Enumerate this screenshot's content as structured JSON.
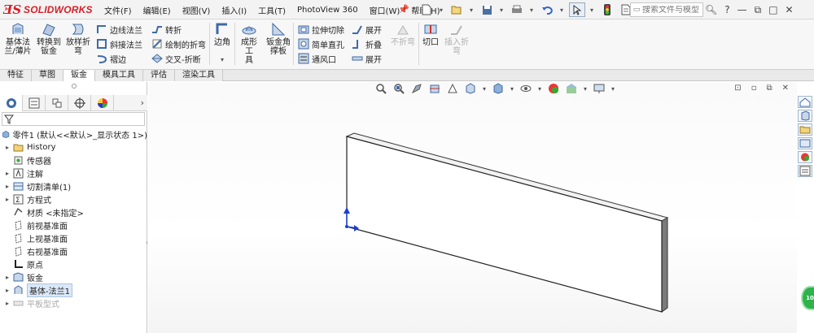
{
  "app": {
    "logo_text": "SOLIDWORKS"
  },
  "menu": [
    "文件(F)",
    "编辑(E)",
    "视图(V)",
    "插入(I)",
    "工具(T)",
    "PhotoView 360",
    "窗口(W)",
    "帮助(H)"
  ],
  "search": {
    "placeholder": "搜索文件与模型"
  },
  "title_right": {
    "help": "?"
  },
  "ribbon": {
    "base_flange": "基体法\n兰/薄片",
    "convert_to_sheet": "转换到\n钣金",
    "lofted_bend": "放样折\n弯",
    "edge_flange": "边线法兰",
    "miter_flange": "斜接法兰",
    "hem": "褶边",
    "jog": "转折",
    "sketched_bend": "绘制的折弯",
    "cross_break": "交叉-折断",
    "corners": "边角",
    "forming_tool": "成形工\n具",
    "sheet_gusset": "钣金角\n撑板",
    "extruded_cut": "拉伸切除",
    "simple_hole": "简单直孔",
    "vent": "通风口",
    "unfold": "展开",
    "fold": "折叠",
    "flatten": "展开",
    "no_bends": "不折弯",
    "rip": "切口",
    "insert_bends": "插入折\n弯"
  },
  "tabs": [
    {
      "label": "特征",
      "active": false
    },
    {
      "label": "草图",
      "active": false
    },
    {
      "label": "钣金",
      "active": true
    },
    {
      "label": "模具工具",
      "active": false
    },
    {
      "label": "评估",
      "active": false
    },
    {
      "label": "渲染工具",
      "active": false
    }
  ],
  "tree": {
    "root": "零件1 (默认<<默认>_显示状态 1>)",
    "items": [
      {
        "label": "History",
        "expand": true
      },
      {
        "label": "传感器",
        "expand": false
      },
      {
        "label": "注解",
        "expand": true
      },
      {
        "label": "切割清单(1)",
        "expand": true
      },
      {
        "label": "方程式",
        "expand": true
      },
      {
        "label": "材质 <未指定>",
        "expand": false
      },
      {
        "label": "前视基准面",
        "expand": false
      },
      {
        "label": "上视基准面",
        "expand": false
      },
      {
        "label": "右视基准面",
        "expand": false
      },
      {
        "label": "原点",
        "expand": false
      },
      {
        "label": "钣金",
        "expand": true
      },
      {
        "label": "基体-法兰1",
        "expand": true
      },
      {
        "label": "平板型式",
        "expand": true
      }
    ]
  },
  "badge": {
    "text": "10"
  }
}
